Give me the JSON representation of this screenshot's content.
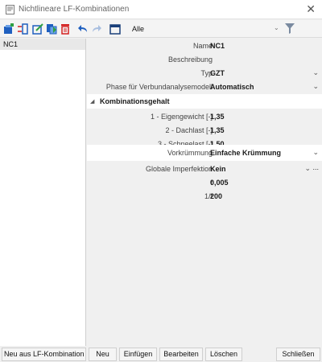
{
  "window": {
    "title": "Nichtlineare LF-Kombinationen",
    "close_glyph": "✕"
  },
  "toolbar": {
    "icons": [
      "new-combination-icon",
      "insert-icon",
      "edit-icon",
      "copy-icon",
      "delete-icon",
      "undo-icon",
      "redo-icon",
      "table-icon"
    ],
    "filter_label": "Alle",
    "filter_caret": "⌄",
    "filter_icon": "filter-funnel-icon"
  },
  "list": {
    "items": [
      "NC1"
    ]
  },
  "properties": {
    "name": {
      "label": "Name",
      "value": "NC1"
    },
    "beschreibung": {
      "label": "Beschreibung",
      "value": ""
    },
    "typ": {
      "label": "Typ",
      "value": "GZT"
    },
    "phase": {
      "label": "Phase für Verbundanalysemodell",
      "value": "Automatisch"
    },
    "group": {
      "title": "Kombinationsgehalt"
    },
    "lf1": {
      "label": "1 - Eigengewicht [-]",
      "value": "1,35"
    },
    "lf2": {
      "label": "2 - Dachlast [-]",
      "value": "1,35"
    },
    "lf3": {
      "label": "3 - Schneelast [-]",
      "value": "1,50"
    },
    "vorkruemmung": {
      "label": "Vorkrümmung",
      "value": "Einfache Krümmung"
    },
    "imperfektion": {
      "label": "Globale Imperfektion",
      "value": "Kein",
      "ellipsis": "..."
    },
    "f": {
      "label": "f",
      "value": "0,005"
    },
    "inv_f": {
      "label": "1/f",
      "value": "200"
    }
  },
  "buttons": {
    "neu_aus": "Neu aus LF-Kombination",
    "neu": "Neu",
    "einfuegen": "Einfügen",
    "bearbeiten": "Bearbeiten",
    "loeschen": "Löschen",
    "schliessen": "Schließen"
  },
  "colors": {
    "accent_blue": "#1f5fbf",
    "delete_red": "#d32020",
    "selection_gray": "#e8e8e8"
  }
}
